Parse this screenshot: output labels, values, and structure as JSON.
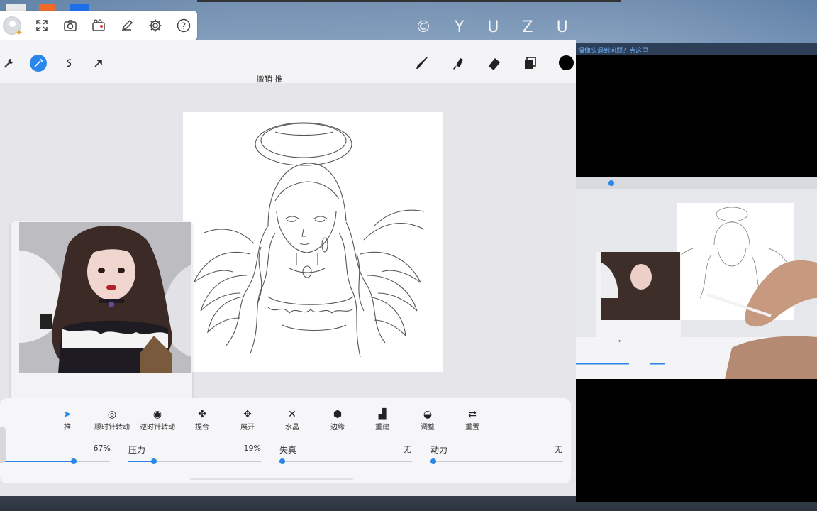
{
  "desktop": {
    "watermark": "© Y U Z U"
  },
  "capture_toolbar": {
    "icons": [
      "avatar",
      "fullscreen-icon",
      "camera-icon",
      "video-camera-icon",
      "pen-icon",
      "gear-icon",
      "help-icon"
    ]
  },
  "procreate": {
    "toolbar": {
      "left_icons": [
        "wrench-icon",
        "magic-wand-icon",
        "selection-icon",
        "transform-arrow-icon"
      ],
      "right_icons": [
        "brush-icon",
        "smudge-icon",
        "eraser-icon",
        "layers-icon"
      ],
      "active_tool": "magic-wand-icon",
      "current_color": "#000000"
    },
    "undo_label": "撤销 推",
    "liquify_modes": [
      {
        "label": "推",
        "icon": "push-icon",
        "active": true
      },
      {
        "label": "顺时针转动",
        "icon": "twirl-right-icon",
        "active": false
      },
      {
        "label": "逆时针转动",
        "icon": "twirl-left-icon",
        "active": false
      },
      {
        "label": "捏合",
        "icon": "pinch-icon",
        "active": false
      },
      {
        "label": "展开",
        "icon": "expand-icon",
        "active": false
      },
      {
        "label": "水晶",
        "icon": "crystals-icon",
        "active": false
      },
      {
        "label": "边缘",
        "icon": "edge-icon",
        "active": false
      },
      {
        "label": "重建",
        "icon": "reconstruct-icon",
        "active": false
      },
      {
        "label": "调整",
        "icon": "adjust-icon",
        "active": false
      },
      {
        "label": "重置",
        "icon": "reset-icon",
        "active": false
      }
    ],
    "sliders": [
      {
        "label": "",
        "value_text": "67%",
        "value": 0.67
      },
      {
        "label": "压力",
        "value_text": "19%",
        "value": 0.19
      },
      {
        "label": "失真",
        "value_text": "无",
        "value": 0.0
      },
      {
        "label": "动力",
        "value_text": "无",
        "value": 0.0
      }
    ],
    "accent_color": "#2a86e8"
  },
  "camera_window": {
    "title_link": "摄像头遇到问题？点这里"
  }
}
